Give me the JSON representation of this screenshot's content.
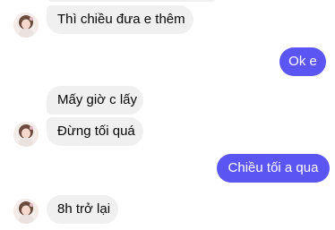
{
  "conversation": {
    "messages": [
      {
        "side": "incoming",
        "text": "Thì chiều đưa e thêm"
      },
      {
        "side": "outgoing",
        "text": "Ok e"
      },
      {
        "side": "incoming",
        "text": "Mấy giờ c lấy"
      },
      {
        "side": "incoming",
        "text": "Đừng tối quá"
      },
      {
        "side": "outgoing",
        "text": "Chiều tối a qua"
      },
      {
        "side": "incoming",
        "text": "8h trở lại"
      }
    ]
  },
  "colors": {
    "incoming_bubble": "#f0f0f0",
    "outgoing_bubble": "#5b55f3",
    "incoming_text": "#050505",
    "outgoing_text": "#ffffff"
  },
  "icons": {
    "avatar": "contact-avatar"
  }
}
